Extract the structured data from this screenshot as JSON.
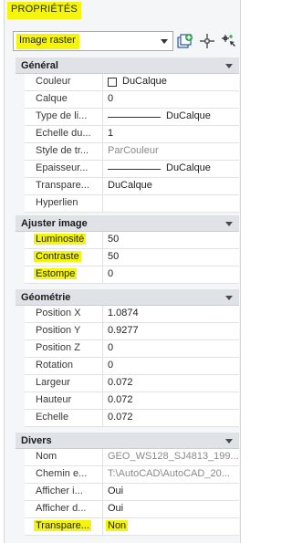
{
  "panel": {
    "title": "PROPRIÉTÉS"
  },
  "selector": {
    "value": "Image raster"
  },
  "sections": {
    "general": {
      "title": "Général",
      "rows": [
        {
          "label": "Couleur",
          "value": "DuCalque"
        },
        {
          "label": "Calque",
          "value": "0"
        },
        {
          "label": "Type de li...",
          "value": "DuCalque"
        },
        {
          "label": "Echelle du...",
          "value": "1"
        },
        {
          "label": "Style de tr...",
          "value": "ParCouleur"
        },
        {
          "label": "Epaisseur...",
          "value": "DuCalque"
        },
        {
          "label": "Transpare...",
          "value": "DuCalque"
        },
        {
          "label": "Hyperlien",
          "value": ""
        }
      ]
    },
    "adjust": {
      "title": "Ajuster image",
      "rows": [
        {
          "label": "Luminosité",
          "value": "50"
        },
        {
          "label": "Contraste",
          "value": "50"
        },
        {
          "label": "Estompe",
          "value": "0"
        }
      ]
    },
    "geometry": {
      "title": "Géométrie",
      "rows": [
        {
          "label": "Position X",
          "value": "1.0874"
        },
        {
          "label": "Position Y",
          "value": "0.9277"
        },
        {
          "label": "Position Z",
          "value": "0"
        },
        {
          "label": "Rotation",
          "value": "0"
        },
        {
          "label": "Largeur",
          "value": "0.072"
        },
        {
          "label": "Hauteur",
          "value": "0.072"
        },
        {
          "label": "Echelle",
          "value": "0.072"
        }
      ]
    },
    "misc": {
      "title": "Divers",
      "rows": [
        {
          "label": "Nom",
          "value": "GEO_WS128_SJ4813_199..."
        },
        {
          "label": "Chemin e...",
          "value": "T:\\AutoCAD\\AutoCAD_20..."
        },
        {
          "label": "Afficher i...",
          "value": "Oui"
        },
        {
          "label": "Afficher d...",
          "value": "Oui"
        },
        {
          "label": "Transpare...",
          "value": "Non"
        }
      ]
    }
  },
  "colors": {
    "highlight": "#f5f50a",
    "header_bg": "#dfe3e8",
    "accent_green": "#2e9e4b"
  },
  "icons": [
    "quick-select-icon",
    "select-objects-icon",
    "toggle-pickadd-icon"
  ]
}
